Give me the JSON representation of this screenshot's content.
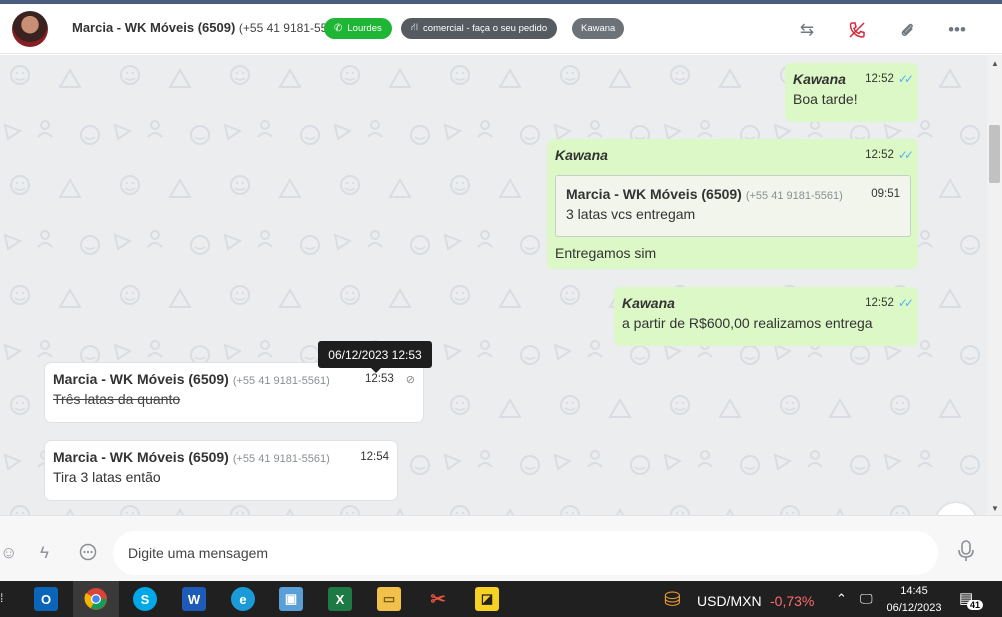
{
  "header": {
    "contact_name": "Marcia - WK Móveis (6509)",
    "contact_phone": "(+55 41 9181-5561)",
    "tags": [
      {
        "label": "Lourdes",
        "color": "#1fb535"
      },
      {
        "label": "comercial - faça o seu pedido",
        "color": "#555b61"
      },
      {
        "label": "Kawana",
        "color": "#6b7278"
      }
    ],
    "icons": [
      "transfer-icon",
      "hangup-icon",
      "attachment-icon",
      "more-icon"
    ]
  },
  "messages": [
    {
      "direction": "out",
      "sender": "Kawana",
      "time": "12:52",
      "text": "Boa tarde!",
      "status": "read"
    },
    {
      "direction": "out",
      "sender": "Kawana",
      "time": "12:52",
      "status": "read",
      "quote": {
        "sender": "Marcia - WK Móveis (6509)",
        "phone": "(+55 41 9181-5561)",
        "time": "09:51",
        "text": "3 latas vcs entregam"
      },
      "text": "Entregamos sim"
    },
    {
      "direction": "out",
      "sender": "Kawana",
      "time": "12:52",
      "text": "a partir de R$600,00 realizamos entrega",
      "status": "read"
    },
    {
      "direction": "in",
      "sender": "Marcia - WK Móveis (6509)",
      "phone": "(+55 41 9181-5561)",
      "time": "12:53",
      "text": "Três latas da quanto",
      "deleted": true
    },
    {
      "direction": "in",
      "sender": "Marcia - WK Móveis (6509)",
      "phone": "(+55 41 9181-5561)",
      "time": "12:54",
      "text": "Tira 3 latas então"
    }
  ],
  "tooltip": "06/12/2023 12:53",
  "composer": {
    "placeholder": "Digite uma mensagem"
  },
  "taskbar": {
    "apps": [
      "outlook",
      "chrome",
      "skype",
      "word",
      "edge",
      "remote-desktop",
      "excel",
      "file-explorer",
      "snipping-tool",
      "sticky-notes"
    ],
    "active_app": "chrome",
    "ticker_label": "USD/MXN",
    "ticker_change": "-0,73%",
    "clock_time": "14:45",
    "clock_date": "06/12/2023",
    "notification_count": "41"
  },
  "colors": {
    "outgoing_bubble": "#dcf8c6",
    "incoming_bubble": "#ffffff",
    "read_check": "#4fb6ec",
    "hangup_red": "#d8283b"
  }
}
